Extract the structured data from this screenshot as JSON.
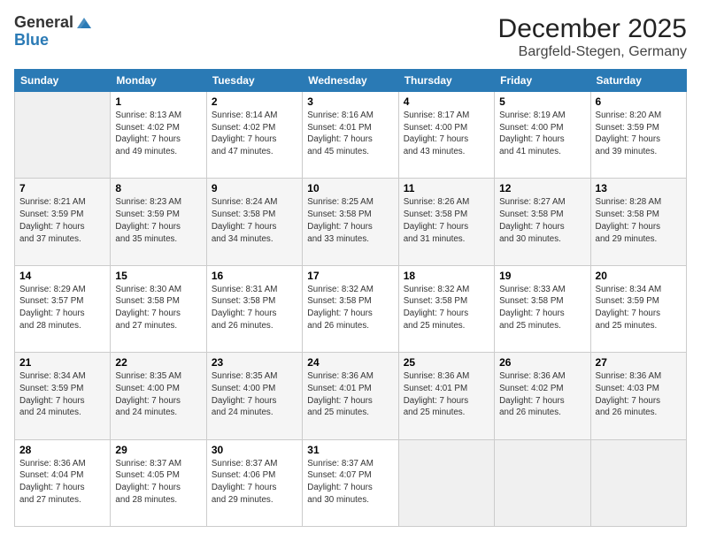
{
  "header": {
    "logo_line1": "General",
    "logo_line2": "Blue",
    "month": "December 2025",
    "location": "Bargfeld-Stegen, Germany"
  },
  "weekdays": [
    "Sunday",
    "Monday",
    "Tuesday",
    "Wednesday",
    "Thursday",
    "Friday",
    "Saturday"
  ],
  "weeks": [
    [
      {
        "day": "",
        "info": ""
      },
      {
        "day": "1",
        "info": "Sunrise: 8:13 AM\nSunset: 4:02 PM\nDaylight: 7 hours\nand 49 minutes."
      },
      {
        "day": "2",
        "info": "Sunrise: 8:14 AM\nSunset: 4:02 PM\nDaylight: 7 hours\nand 47 minutes."
      },
      {
        "day": "3",
        "info": "Sunrise: 8:16 AM\nSunset: 4:01 PM\nDaylight: 7 hours\nand 45 minutes."
      },
      {
        "day": "4",
        "info": "Sunrise: 8:17 AM\nSunset: 4:00 PM\nDaylight: 7 hours\nand 43 minutes."
      },
      {
        "day": "5",
        "info": "Sunrise: 8:19 AM\nSunset: 4:00 PM\nDaylight: 7 hours\nand 41 minutes."
      },
      {
        "day": "6",
        "info": "Sunrise: 8:20 AM\nSunset: 3:59 PM\nDaylight: 7 hours\nand 39 minutes."
      }
    ],
    [
      {
        "day": "7",
        "info": "Sunrise: 8:21 AM\nSunset: 3:59 PM\nDaylight: 7 hours\nand 37 minutes."
      },
      {
        "day": "8",
        "info": "Sunrise: 8:23 AM\nSunset: 3:59 PM\nDaylight: 7 hours\nand 35 minutes."
      },
      {
        "day": "9",
        "info": "Sunrise: 8:24 AM\nSunset: 3:58 PM\nDaylight: 7 hours\nand 34 minutes."
      },
      {
        "day": "10",
        "info": "Sunrise: 8:25 AM\nSunset: 3:58 PM\nDaylight: 7 hours\nand 33 minutes."
      },
      {
        "day": "11",
        "info": "Sunrise: 8:26 AM\nSunset: 3:58 PM\nDaylight: 7 hours\nand 31 minutes."
      },
      {
        "day": "12",
        "info": "Sunrise: 8:27 AM\nSunset: 3:58 PM\nDaylight: 7 hours\nand 30 minutes."
      },
      {
        "day": "13",
        "info": "Sunrise: 8:28 AM\nSunset: 3:58 PM\nDaylight: 7 hours\nand 29 minutes."
      }
    ],
    [
      {
        "day": "14",
        "info": "Sunrise: 8:29 AM\nSunset: 3:57 PM\nDaylight: 7 hours\nand 28 minutes."
      },
      {
        "day": "15",
        "info": "Sunrise: 8:30 AM\nSunset: 3:58 PM\nDaylight: 7 hours\nand 27 minutes."
      },
      {
        "day": "16",
        "info": "Sunrise: 8:31 AM\nSunset: 3:58 PM\nDaylight: 7 hours\nand 26 minutes."
      },
      {
        "day": "17",
        "info": "Sunrise: 8:32 AM\nSunset: 3:58 PM\nDaylight: 7 hours\nand 26 minutes."
      },
      {
        "day": "18",
        "info": "Sunrise: 8:32 AM\nSunset: 3:58 PM\nDaylight: 7 hours\nand 25 minutes."
      },
      {
        "day": "19",
        "info": "Sunrise: 8:33 AM\nSunset: 3:58 PM\nDaylight: 7 hours\nand 25 minutes."
      },
      {
        "day": "20",
        "info": "Sunrise: 8:34 AM\nSunset: 3:59 PM\nDaylight: 7 hours\nand 25 minutes."
      }
    ],
    [
      {
        "day": "21",
        "info": "Sunrise: 8:34 AM\nSunset: 3:59 PM\nDaylight: 7 hours\nand 24 minutes."
      },
      {
        "day": "22",
        "info": "Sunrise: 8:35 AM\nSunset: 4:00 PM\nDaylight: 7 hours\nand 24 minutes."
      },
      {
        "day": "23",
        "info": "Sunrise: 8:35 AM\nSunset: 4:00 PM\nDaylight: 7 hours\nand 24 minutes."
      },
      {
        "day": "24",
        "info": "Sunrise: 8:36 AM\nSunset: 4:01 PM\nDaylight: 7 hours\nand 25 minutes."
      },
      {
        "day": "25",
        "info": "Sunrise: 8:36 AM\nSunset: 4:01 PM\nDaylight: 7 hours\nand 25 minutes."
      },
      {
        "day": "26",
        "info": "Sunrise: 8:36 AM\nSunset: 4:02 PM\nDaylight: 7 hours\nand 26 minutes."
      },
      {
        "day": "27",
        "info": "Sunrise: 8:36 AM\nSunset: 4:03 PM\nDaylight: 7 hours\nand 26 minutes."
      }
    ],
    [
      {
        "day": "28",
        "info": "Sunrise: 8:36 AM\nSunset: 4:04 PM\nDaylight: 7 hours\nand 27 minutes."
      },
      {
        "day": "29",
        "info": "Sunrise: 8:37 AM\nSunset: 4:05 PM\nDaylight: 7 hours\nand 28 minutes."
      },
      {
        "day": "30",
        "info": "Sunrise: 8:37 AM\nSunset: 4:06 PM\nDaylight: 7 hours\nand 29 minutes."
      },
      {
        "day": "31",
        "info": "Sunrise: 8:37 AM\nSunset: 4:07 PM\nDaylight: 7 hours\nand 30 minutes."
      },
      {
        "day": "",
        "info": ""
      },
      {
        "day": "",
        "info": ""
      },
      {
        "day": "",
        "info": ""
      }
    ]
  ]
}
